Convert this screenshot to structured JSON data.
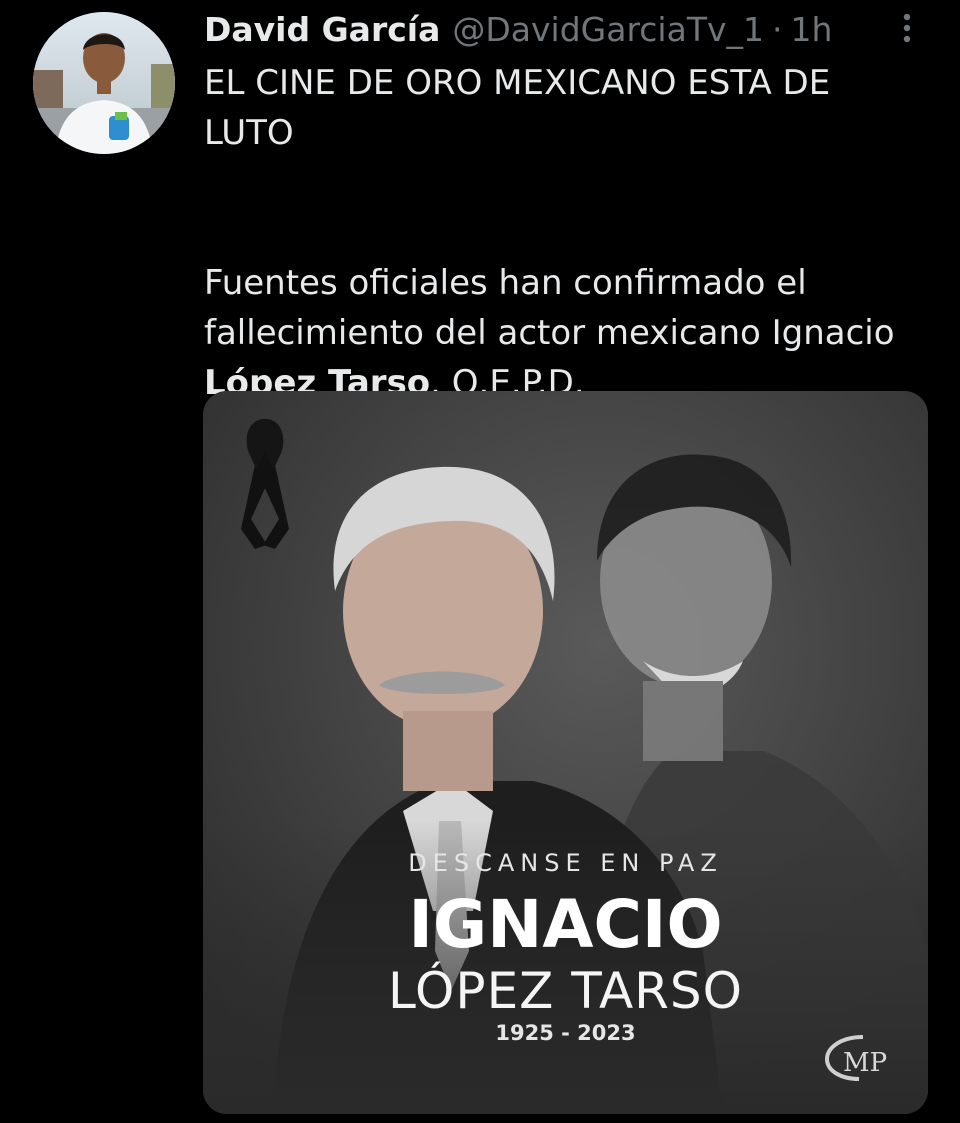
{
  "tweet": {
    "author": {
      "display_name": "David García",
      "handle": "@DavidGarciaTv_1",
      "separator": "·",
      "time": "1h"
    },
    "text": {
      "line1": "EL CINE DE ORO MEXICANO ESTA DE LUTO",
      "line2_before": "Fuentes oficiales han confirmado el fallecimiento del actor mexicano Ignacio ",
      "line2_bold": "López Tarso",
      "line2_after": ". Q.E.P.D."
    },
    "media": {
      "kicker": "DESCANSE EN PAZ",
      "first_name": "IGNACIO",
      "last_name": "LÓPEZ TARSO",
      "years": "1925 - 2023",
      "logo_text": "MP"
    },
    "icons": {
      "more": "more-vertical-icon",
      "ribbon": "mourning-ribbon-icon"
    },
    "colors": {
      "background": "#000000",
      "primary_text": "#e7e9ea",
      "secondary_text": "#71767b",
      "card_background": "#3c3c3c"
    }
  }
}
